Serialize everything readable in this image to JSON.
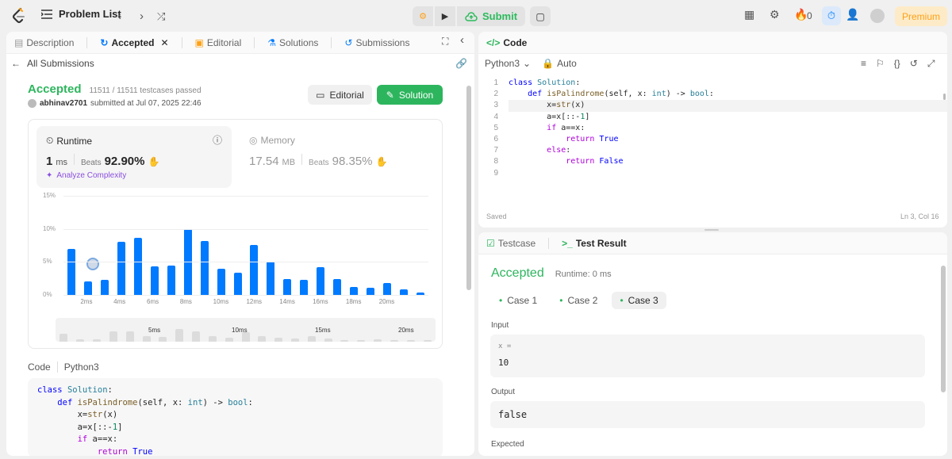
{
  "topbar": {
    "problem_list": "Problem List",
    "submit": "Submit",
    "streak": "0",
    "premium": "Premium"
  },
  "left_tabs": [
    {
      "label": "Description"
    },
    {
      "label": "Accepted"
    },
    {
      "label": "Editorial"
    },
    {
      "label": "Solutions"
    },
    {
      "label": "Submissions"
    }
  ],
  "submission": {
    "back_label": "All Submissions",
    "status": "Accepted",
    "testcases": "11511 / 11511 testcases passed",
    "user": "abhinav2701",
    "submitted_at": "submitted at Jul 07, 2025 22:46",
    "editorial_btn": "Editorial",
    "solution_btn": "Solution"
  },
  "runtime": {
    "label": "Runtime",
    "value": "1",
    "unit": "ms",
    "beats_label": "Beats",
    "beats": "92.90%",
    "analyze": "Analyze Complexity"
  },
  "memory": {
    "label": "Memory",
    "value": "17.54",
    "unit": "MB",
    "beats_label": "Beats",
    "beats": "98.35%"
  },
  "chart_data": {
    "type": "bar",
    "yticks": [
      "15%",
      "10%",
      "5%",
      "0%"
    ],
    "ylim": [
      0,
      15
    ],
    "xticks": [
      "2ms",
      "4ms",
      "6ms",
      "8ms",
      "10ms",
      "12ms",
      "14ms",
      "16ms",
      "18ms",
      "20ms"
    ],
    "values": [
      7.0,
      2.0,
      2.3,
      8.0,
      8.7,
      4.3,
      4.4,
      10.0,
      8.2,
      4.0,
      3.4,
      7.6,
      5.0,
      2.4,
      2.3,
      4.2,
      2.4,
      1.2,
      1.1,
      1.8,
      0.9,
      0.4
    ],
    "minimap_labels": [
      "5ms",
      "10ms",
      "15ms",
      "20ms"
    ],
    "minimap_values": [
      0.45,
      0.12,
      0.12,
      0.6,
      0.6,
      0.3,
      0.28,
      0.75,
      0.6,
      0.3,
      0.22,
      0.55,
      0.3,
      0.22,
      0.18,
      0.3,
      0.16,
      0.1,
      0.1,
      0.14,
      0.08,
      0.05,
      0.1
    ]
  },
  "code_section": {
    "label": "Code",
    "lang": "Python3"
  },
  "editor": {
    "title": "Code",
    "lang": "Python3",
    "mode": "Auto",
    "saved": "Saved",
    "position": "Ln 3, Col 16",
    "line_numbers": [
      "1",
      "2",
      "3",
      "4",
      "5",
      "6",
      "7",
      "8",
      "9"
    ]
  },
  "testpanel": {
    "tab_testcase": "Testcase",
    "tab_result": "Test Result",
    "status": "Accepted",
    "runtime": "Runtime: 0 ms",
    "cases": [
      "Case 1",
      "Case 2",
      "Case 3"
    ],
    "input_label": "Input",
    "var_label": "x =",
    "input_value": "10",
    "output_label": "Output",
    "output_value": "false",
    "expected_label": "Expected"
  },
  "colors": {
    "accepted_green": "#2db55d",
    "bar_blue": "#007aff",
    "premium_orange": "#ffa116"
  }
}
